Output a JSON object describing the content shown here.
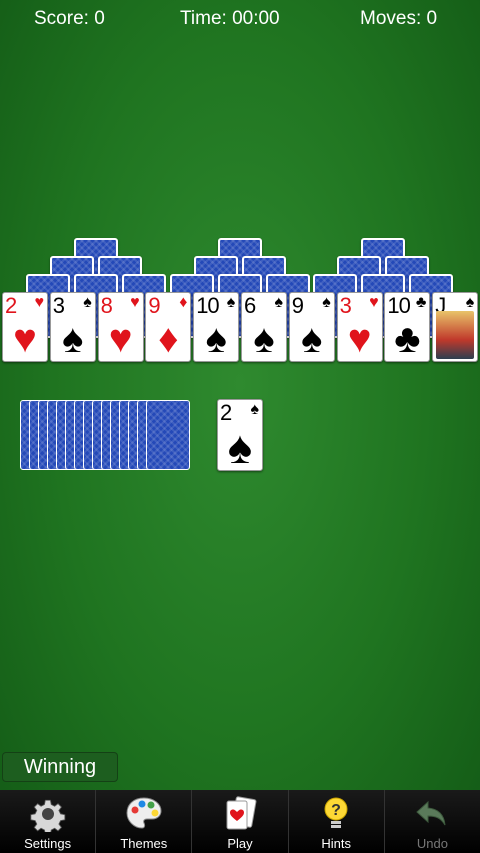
{
  "hud": {
    "score": "Score: 0",
    "time": "Time: 00:00",
    "moves": "Moves: 0"
  },
  "tableau_bottom": [
    {
      "rank": "2",
      "suit": "♥",
      "color": "red"
    },
    {
      "rank": "3",
      "suit": "♠",
      "color": "black"
    },
    {
      "rank": "8",
      "suit": "♥",
      "color": "red"
    },
    {
      "rank": "9",
      "suit": "♦",
      "color": "red"
    },
    {
      "rank": "10",
      "suit": "♠",
      "color": "black"
    },
    {
      "rank": "6",
      "suit": "♠",
      "color": "black"
    },
    {
      "rank": "9",
      "suit": "♠",
      "color": "black"
    },
    {
      "rank": "3",
      "suit": "♥",
      "color": "red"
    },
    {
      "rank": "10",
      "suit": "♣",
      "color": "black"
    },
    {
      "rank": "J",
      "suit": "♠",
      "color": "black"
    }
  ],
  "waste": {
    "rank": "2",
    "suit": "♠",
    "color": "black"
  },
  "status": {
    "label": "Winning"
  },
  "toolbar": {
    "settings": "Settings",
    "themes": "Themes",
    "play": "Play",
    "hints": "Hints",
    "undo": "Undo"
  },
  "icons": [
    "gear-icon",
    "palette-icon",
    "cards-icon",
    "hint-bulb-icon",
    "undo-arrow-icon"
  ],
  "colors": {
    "felt": "#1f7420",
    "card_back": "#2449b8",
    "red_suit": "#e0141c"
  }
}
